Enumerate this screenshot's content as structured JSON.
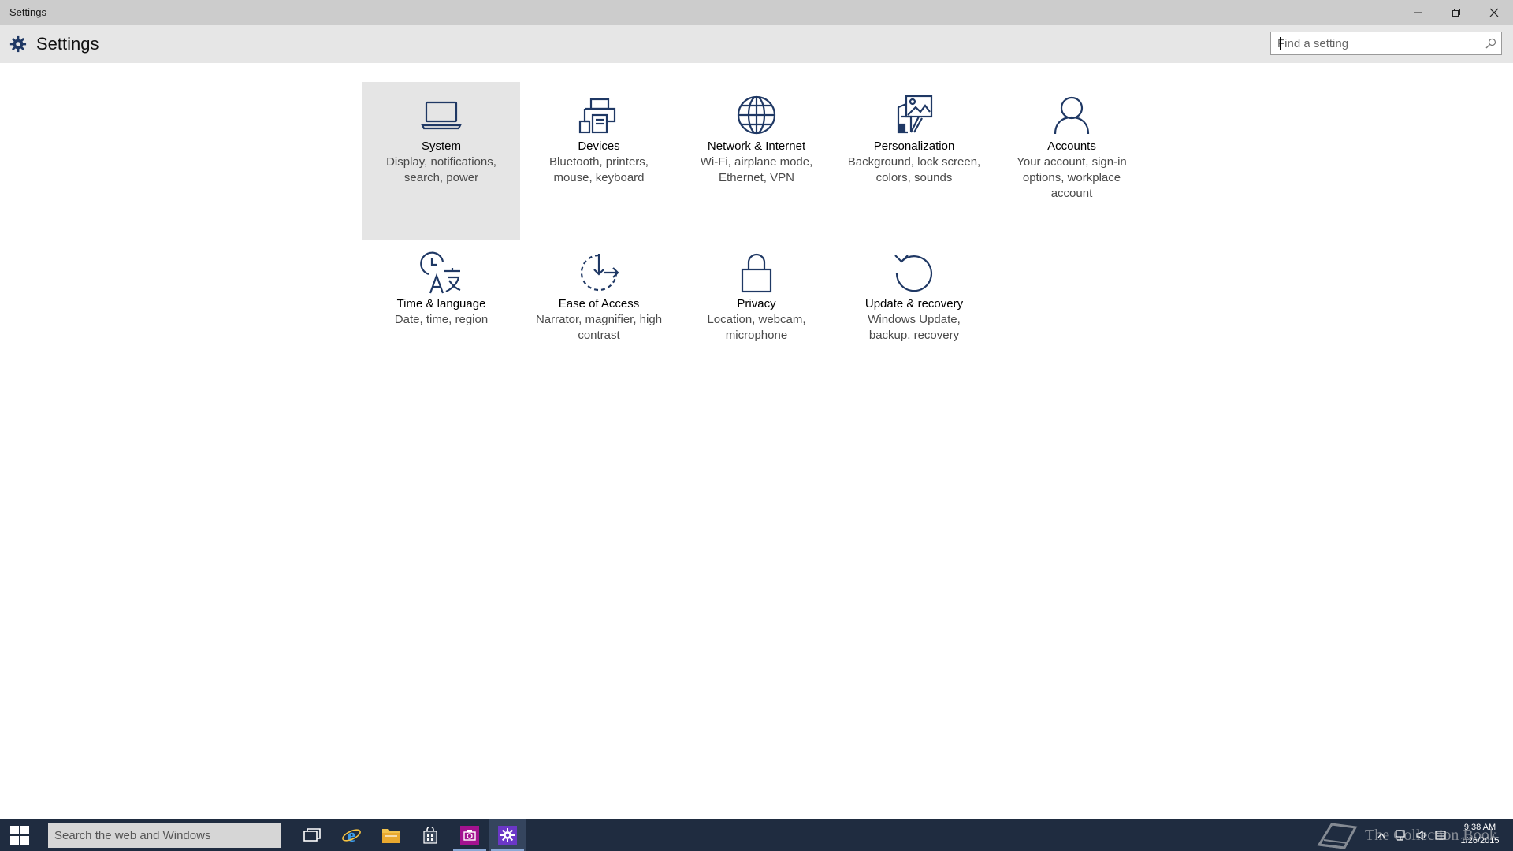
{
  "window": {
    "title": "Settings"
  },
  "header": {
    "app_title": "Settings",
    "search_placeholder": "Find a setting"
  },
  "categories": [
    {
      "name": "System",
      "desc": "Display, notifications, search, power",
      "icon": "laptop-icon",
      "selected": true
    },
    {
      "name": "Devices",
      "desc": "Bluetooth, printers, mouse, keyboard",
      "icon": "devices-icon"
    },
    {
      "name": "Network & Internet",
      "desc": "Wi-Fi, airplane mode, Ethernet, VPN",
      "icon": "globe-icon"
    },
    {
      "name": "Personalization",
      "desc": "Background, lock screen, colors, sounds",
      "icon": "personalization-icon"
    },
    {
      "name": "Accounts",
      "desc": "Your account, sign-in options, workplace account",
      "icon": "person-icon"
    },
    {
      "name": "Time & language",
      "desc": "Date, time, region",
      "icon": "time-language-icon"
    },
    {
      "name": "Ease of Access",
      "desc": "Narrator, magnifier, high contrast",
      "icon": "ease-of-access-icon"
    },
    {
      "name": "Privacy",
      "desc": "Location, webcam, microphone",
      "icon": "lock-icon"
    },
    {
      "name": "Update & recovery",
      "desc": "Windows Update, backup, recovery",
      "icon": "refresh-icon"
    }
  ],
  "taskbar": {
    "search_placeholder": "Search the web and Windows",
    "pinned_apps": [
      "task-view-icon",
      "internet-explorer-icon",
      "file-explorer-icon",
      "store-icon",
      "camera-app-icon",
      "settings-icon"
    ]
  },
  "tray": {
    "time": "9:38 AM",
    "date": "1/26/2015"
  },
  "watermark": {
    "text": "The Collection Book"
  },
  "colors": {
    "icon_blue": "#1f3864",
    "title_bar": "#cccccc",
    "header_bar": "#e6e6e6",
    "selected_tile": "#e5e5e5",
    "taskbar": "#1f2c40"
  }
}
